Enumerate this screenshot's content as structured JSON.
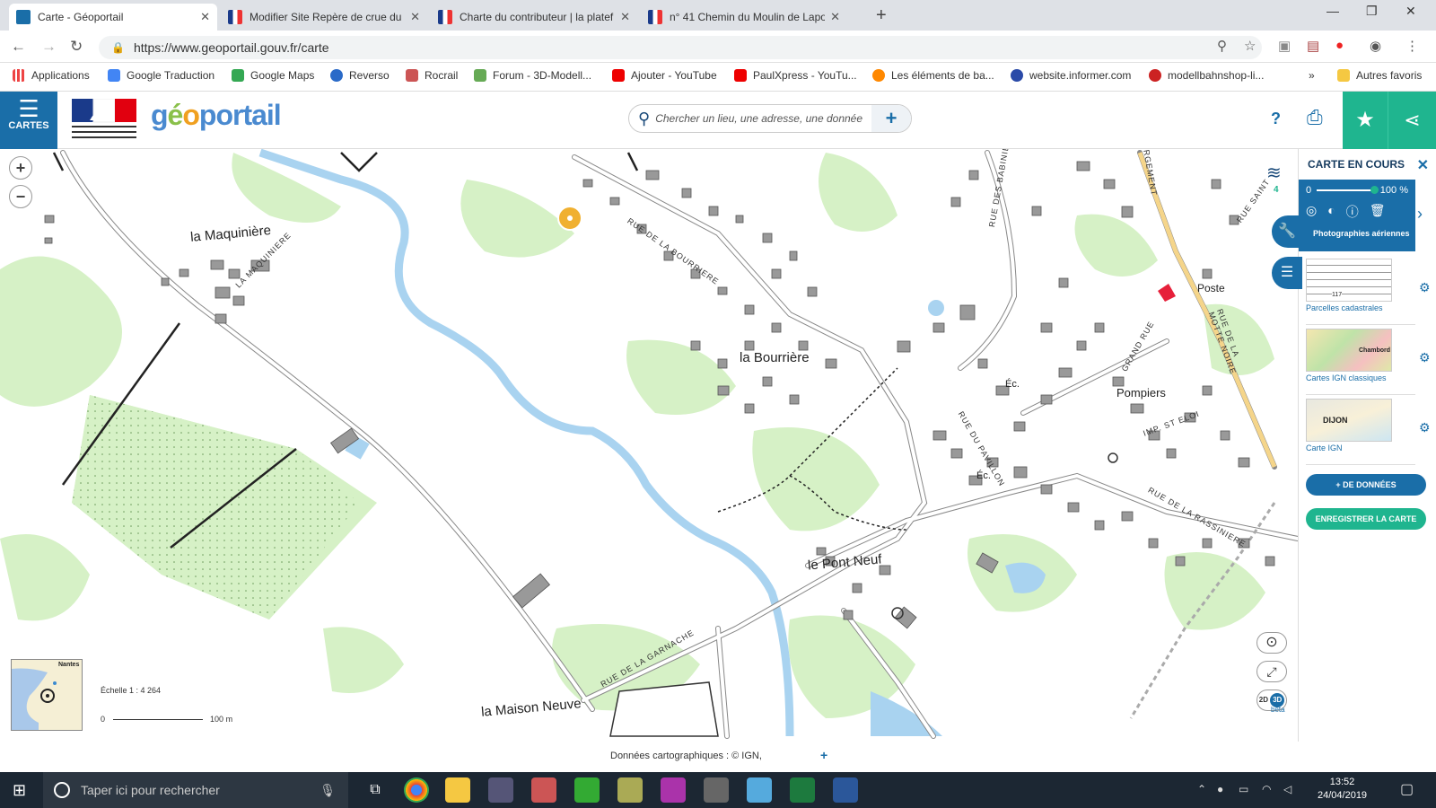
{
  "browser": {
    "tabs": [
      {
        "title": "Carte - Géoportail",
        "active": true
      },
      {
        "title": "Modifier Site Repère de crue du I",
        "active": false
      },
      {
        "title": "Charte du contributeur | la platef",
        "active": false
      },
      {
        "title": "n° 41 Chemin du Moulin de Lapo",
        "active": false
      }
    ],
    "url": "https://www.geoportail.gouv.fr/carte",
    "bookmarks": [
      "Applications",
      "Google Traduction",
      "Google Maps",
      "Reverso",
      "Rocrail",
      "Forum - 3D-Modell...",
      "Ajouter - YouTube",
      "PaulXpress - YouTu...",
      "Les éléments de ba...",
      "website.informer.com",
      "modellbahnshop-li...",
      "Autres favoris"
    ],
    "bookmarks_overflow": "»"
  },
  "header": {
    "menu_label": "CARTES",
    "logo_text": "géoportail",
    "search_placeholder": "Chercher un lieu, une adresse, une donnée",
    "help_label": "?"
  },
  "map": {
    "places": [
      {
        "label": "la Maquinière"
      },
      {
        "label": "la Bourrière"
      },
      {
        "label": "le Pont Neuf"
      },
      {
        "label": "la Maison Neuve"
      },
      {
        "label": "Pompiers"
      },
      {
        "label": "Poste"
      },
      {
        "label": "Éc."
      },
      {
        "label": "Éc."
      }
    ],
    "streets": [
      "RUE DE LA BOURRIERE",
      "RUE DES BABINIERES",
      "LA MAQUINIERE",
      "RUE DE LA GARNACHE",
      "RUE DE LA MOTTE NOIRE",
      "GRAND RUE",
      "RUE DU PAVILLON",
      "IMP. ST ELOI",
      "RUE DE LA RASSINIERE",
      "RUE SAINT",
      "RGEMENT"
    ],
    "scale_label": "Échelle 1 : 4 264",
    "scale_min": "0",
    "scale_max": "100 m",
    "minimap_city": "Nantes",
    "credits": "Données cartographiques : © IGN,",
    "mode_2d": "2D",
    "mode_3d": "3D",
    "mode_3d_sub": "bêta"
  },
  "panel": {
    "title": "CARTE EN COURS",
    "layer_count": "4",
    "opacity_min": "0",
    "opacity_value": "100 %",
    "active_layer": "Photographies aériennes",
    "layers": [
      {
        "name": "Parcelles cadastrales"
      },
      {
        "name": "Cartes IGN classiques"
      },
      {
        "name": "Carte IGN"
      }
    ],
    "thumb_labels": [
      "117",
      "Chambord",
      "DIJON"
    ],
    "more_data": "+ DE DONNÉES",
    "save_map": "ENREGISTRER LA CARTE"
  },
  "taskbar": {
    "search_placeholder": "Taper ici pour rechercher",
    "time": "13:52",
    "date": "24/04/2019"
  },
  "colors": {
    "blue": "#1a6ea8",
    "green": "#1fb58f",
    "vegetation": "#d6f1c6",
    "water": "#a9d3f0"
  }
}
